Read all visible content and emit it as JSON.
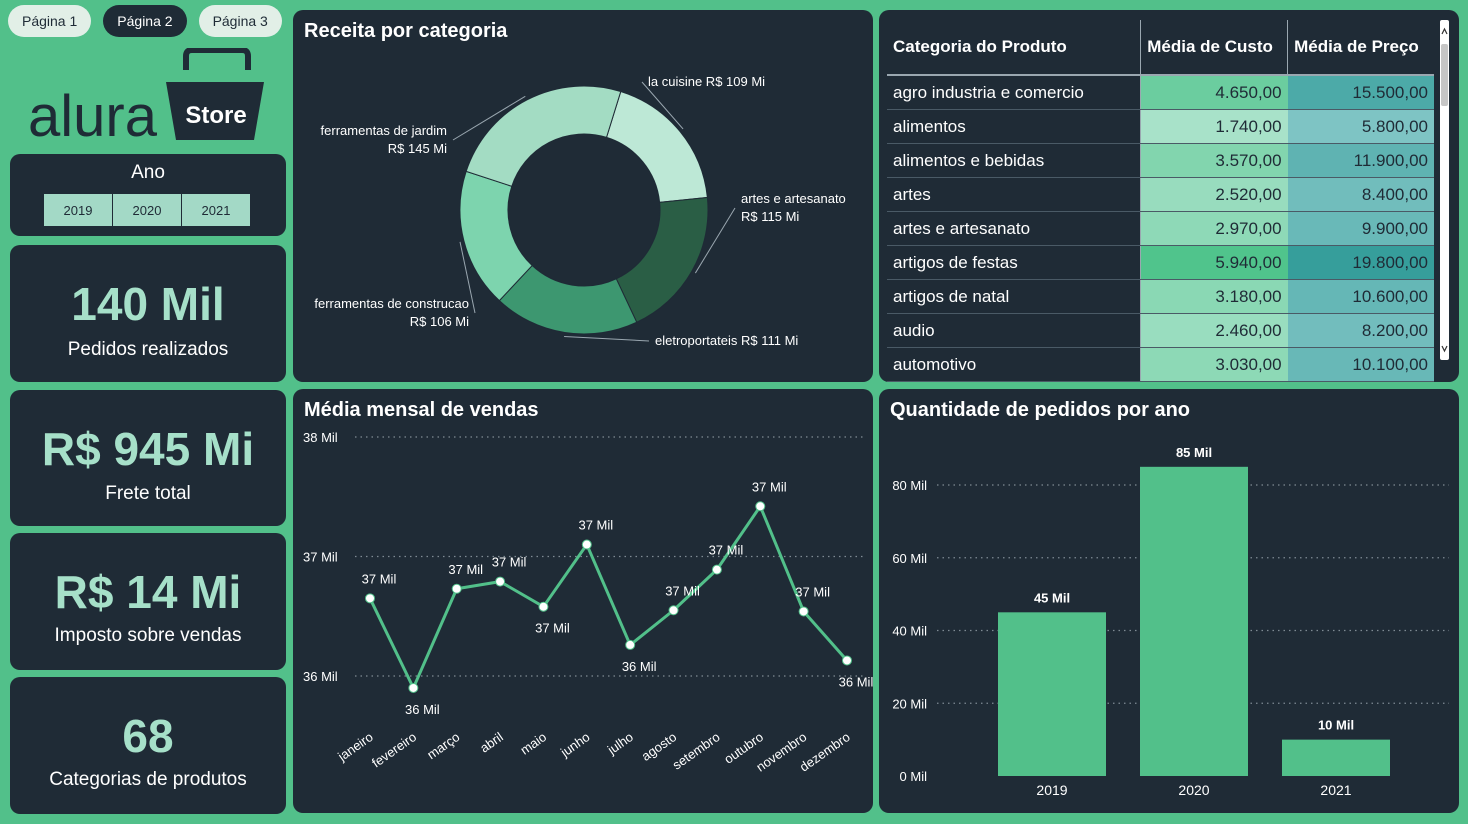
{
  "tabs": [
    "Página 1",
    "Página 2",
    "Página 3"
  ],
  "logo": {
    "brand": "alura",
    "badge": "Store"
  },
  "slicer": {
    "title": "Ano",
    "options": [
      "2019",
      "2020",
      "2021"
    ]
  },
  "kpis": [
    {
      "value": "140 Mil",
      "label": "Pedidos realizados"
    },
    {
      "value": "R$ 945 Mi",
      "label": "Frete total"
    },
    {
      "value": "R$ 14 Mi",
      "label": "Imposto sobre vendas"
    },
    {
      "value": "68",
      "label": "Categorias de produtos"
    }
  ],
  "colors": {
    "background": "#52c08a",
    "panel": "#1f2b36",
    "accent": "#52c08a",
    "kpi_text": "#a6e0c9"
  },
  "table": {
    "headers": [
      "Categoria do Produto",
      "Média de Custo",
      "Média de Preço"
    ],
    "rows": [
      {
        "cat": "agro industria e comercio",
        "custo": "4.650,00",
        "preco": "15.500,00"
      },
      {
        "cat": "alimentos",
        "custo": "1.740,00",
        "preco": "5.800,00"
      },
      {
        "cat": "alimentos e bebidas",
        "custo": "3.570,00",
        "preco": "11.900,00"
      },
      {
        "cat": "artes",
        "custo": "2.520,00",
        "preco": "8.400,00"
      },
      {
        "cat": "artes e artesanato",
        "custo": "2.970,00",
        "preco": "9.900,00"
      },
      {
        "cat": "artigos de festas",
        "custo": "5.940,00",
        "preco": "19.800,00"
      },
      {
        "cat": "artigos de natal",
        "custo": "3.180,00",
        "preco": "10.600,00"
      },
      {
        "cat": "audio",
        "custo": "2.460,00",
        "preco": "8.200,00"
      },
      {
        "cat": "automotivo",
        "custo": "3.030,00",
        "preco": "10.100,00"
      }
    ]
  },
  "chart_data": [
    {
      "type": "pie",
      "title": "Receita por categoria",
      "donut": true,
      "slices": [
        {
          "name": "la cuisine",
          "value": 109,
          "value_label": "R$ 109 Mi",
          "color": "#bde8d6"
        },
        {
          "name": "artes e artesanato",
          "value": 115,
          "value_label": "R$ 115 Mi",
          "color": "#2a5e45"
        },
        {
          "name": "eletroportateis",
          "value": 111,
          "value_label": "R$ 111 Mi",
          "color": "#3d9770"
        },
        {
          "name": "ferramentas de construcao",
          "value": 106,
          "value_label": "R$ 106 Mi",
          "color": "#7dd4ae"
        },
        {
          "name": "ferramentas de jardim",
          "value": 145,
          "value_label": "R$ 145 Mi",
          "color": "#a3dcc3"
        }
      ],
      "unit": "R$ Mi"
    },
    {
      "type": "line",
      "title": "Média mensal de vendas",
      "categories": [
        "janeiro",
        "fevereiro",
        "março",
        "abril",
        "maio",
        "junho",
        "julho",
        "agosto",
        "setembro",
        "outubro",
        "novembro",
        "dezembro"
      ],
      "values": [
        36.65,
        35.9,
        36.73,
        36.79,
        36.58,
        37.1,
        36.26,
        36.55,
        36.89,
        37.42,
        36.54,
        36.13
      ],
      "data_labels": [
        "37 Mil",
        "36 Mil",
        "37 Mil",
        "37 Mil",
        "37 Mil",
        "37 Mil",
        "36 Mil",
        "37 Mil",
        "37 Mil",
        "37 Mil",
        "37 Mil",
        "36 Mil"
      ],
      "yticks": [
        36,
        37,
        38
      ],
      "ytick_labels": [
        "36 Mil",
        "37 Mil",
        "38 Mil"
      ],
      "ylim": [
        36,
        38
      ],
      "grid": true,
      "color": "#52c08a"
    },
    {
      "type": "bar",
      "title": "Quantidade de pedidos por ano",
      "categories": [
        "2019",
        "2020",
        "2021"
      ],
      "values": [
        45,
        85,
        10
      ],
      "data_labels": [
        "45 Mil",
        "85 Mil",
        "10 Mil"
      ],
      "yticks": [
        0,
        20,
        40,
        60,
        80
      ],
      "ytick_labels": [
        "0 Mil",
        "20 Mil",
        "40 Mil",
        "60 Mil",
        "80 Mil"
      ],
      "ylim": [
        0,
        85
      ],
      "grid": true,
      "color": "#52c08a"
    }
  ]
}
